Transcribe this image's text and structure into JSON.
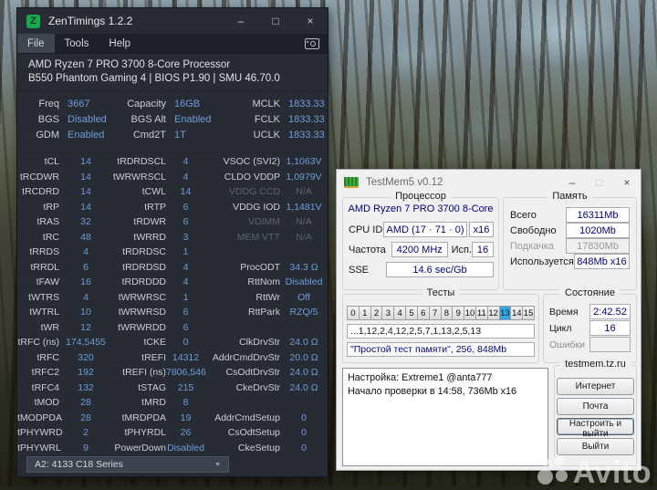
{
  "zentimings": {
    "window_title": "ZenTimings 1.2.2",
    "logo_letter": "Z",
    "controls": {
      "minimize": "–",
      "maximize": "□",
      "close": "×"
    },
    "menu": [
      "File",
      "Tools",
      "Help"
    ],
    "cpu_line1": "AMD Ryzen 7 PRO 3700 8-Core Processor",
    "board_line": "B550 Phantom Gaming 4 | BIOS P1.90 | SMU 46.70.0",
    "freq_rows": [
      {
        "c1l": "Freq",
        "c1v": "3667",
        "c2l": "Capacity",
        "c2v": "16GB",
        "c3l": "MCLK",
        "c3v": "1833.33"
      },
      {
        "c1l": "BGS",
        "c1v": "Disabled",
        "c2l": "BGS Alt",
        "c2v": "Enabled",
        "c3l": "FCLK",
        "c3v": "1833.33"
      },
      {
        "c1l": "GDM",
        "c1v": "Enabled",
        "c2l": "Cmd2T",
        "c2v": "1T",
        "c3l": "UCLK",
        "c3v": "1833.33"
      }
    ],
    "timing_rows": [
      {
        "c1l": "tCL",
        "c1v": "14",
        "c2l": "tRDRDSCL",
        "c2v": "4",
        "c3l": "VSOC (SVI2)",
        "c3v": "1,1063V",
        "c3na": false
      },
      {
        "c1l": "tRCDWR",
        "c1v": "14",
        "c2l": "tWRWRSCL",
        "c2v": "4",
        "c3l": "CLDO VDDP",
        "c3v": "1,0979V",
        "c3na": false
      },
      {
        "c1l": "tRCDRD",
        "c1v": "14",
        "c2l": "tCWL",
        "c2v": "14",
        "c3l": "VDDG CCD",
        "c3v": "N/A",
        "c3na": true
      },
      {
        "c1l": "tRP",
        "c1v": "14",
        "c2l": "tRTP",
        "c2v": "6",
        "c3l": "VDDG IOD",
        "c3v": "1,1481V",
        "c3na": false
      },
      {
        "c1l": "tRAS",
        "c1v": "32",
        "c2l": "tRDWR",
        "c2v": "6",
        "c3l": "VDIMM",
        "c3v": "N/A",
        "c3na": true
      },
      {
        "c1l": "tRC",
        "c1v": "48",
        "c2l": "tWRRD",
        "c2v": "3",
        "c3l": "MEM VTT",
        "c3v": "N/A",
        "c3na": true
      },
      {
        "c1l": "tRRDS",
        "c1v": "4",
        "c2l": "tRDRDSC",
        "c2v": "1",
        "c3l": "",
        "c3v": "",
        "c3na": false
      },
      {
        "c1l": "tRRDL",
        "c1v": "6",
        "c2l": "tRDRDSD",
        "c2v": "4",
        "c3l": "ProcODT",
        "c3v": "34.3 Ω",
        "c3na": false
      },
      {
        "c1l": "tFAW",
        "c1v": "16",
        "c2l": "tRDRDDD",
        "c2v": "4",
        "c3l": "RttNom",
        "c3v": "Disabled",
        "c3na": false
      },
      {
        "c1l": "tWTRS",
        "c1v": "4",
        "c2l": "tWRWRSC",
        "c2v": "1",
        "c3l": "RttWr",
        "c3v": "Off",
        "c3na": false
      },
      {
        "c1l": "tWTRL",
        "c1v": "10",
        "c2l": "tWRWRSD",
        "c2v": "6",
        "c3l": "RttPark",
        "c3v": "RZQ/5",
        "c3na": false
      },
      {
        "c1l": "tWR",
        "c1v": "12",
        "c2l": "tWRWRDD",
        "c2v": "6",
        "c3l": "",
        "c3v": "",
        "c3na": false
      },
      {
        "c1l": "tRFC (ns)",
        "c1v": "174,5455",
        "c2l": "tCKE",
        "c2v": "0",
        "c3l": "ClkDrvStr",
        "c3v": "24.0 Ω",
        "c3na": false
      },
      {
        "c1l": "tRFC",
        "c1v": "320",
        "c2l": "tREFI",
        "c2v": "14312",
        "c3l": "AddrCmdDrvStr",
        "c3v": "20.0 Ω",
        "c3na": false
      },
      {
        "c1l": "tRFC2",
        "c1v": "192",
        "c2l": "tREFI (ns)",
        "c2v": "7806,546",
        "c3l": "CsOdtDrvStr",
        "c3v": "24.0 Ω",
        "c3na": false
      },
      {
        "c1l": "tRFC4",
        "c1v": "132",
        "c2l": "tSTAG",
        "c2v": "215",
        "c3l": "CkeDrvStr",
        "c3v": "24.0 Ω",
        "c3na": false
      },
      {
        "c1l": "tMOD",
        "c1v": "28",
        "c2l": "tMRD",
        "c2v": "8",
        "c3l": "",
        "c3v": "",
        "c3na": false
      },
      {
        "c1l": "tMODPDA",
        "c1v": "28",
        "c2l": "tMRDPDA",
        "c2v": "19",
        "c3l": "AddrCmdSetup",
        "c3v": "0",
        "c3na": false
      },
      {
        "c1l": "tPHYWRD",
        "c1v": "2",
        "c2l": "tPHYRDL",
        "c2v": "26",
        "c3l": "CsOdtSetup",
        "c3v": "0",
        "c3na": false
      },
      {
        "c1l": "tPHYWRL",
        "c1v": "9",
        "c2l": "PowerDown",
        "c2v": "Disabled",
        "c3l": "CkeSetup",
        "c3v": "0",
        "c3na": false
      }
    ],
    "profile_selector": "A2: 4133 C18 Series"
  },
  "testmem5": {
    "window_title": "TestMem5 v0.12",
    "controls": {
      "minimize": "–",
      "maximize": "□",
      "close": "×"
    },
    "processor": {
      "title": "Процессор",
      "cpu_name": "AMD Ryzen 7 PRO 3700 8-Core",
      "cpu_id_label": "CPU ID",
      "cpu_id": "AMD (17 · 71 · 0)",
      "threads": "x16",
      "freq_label": "Частота",
      "freq": "4200 MHz",
      "used_label": "Исп.",
      "used": "16",
      "sse_label": "SSE",
      "sse": "14.6 sec/Gb"
    },
    "memory": {
      "title": "Память",
      "rows": [
        {
          "label": "Всего",
          "value": "16311Mb",
          "disabled": false,
          "wide": false
        },
        {
          "label": "Свободно",
          "value": "1020Mb",
          "disabled": false,
          "wide": false
        },
        {
          "label": "Подкачка",
          "value": "17830Mb",
          "disabled": true,
          "wide": false
        },
        {
          "label": "Используется",
          "value": "848Mb x16",
          "disabled": false,
          "wide": true
        }
      ]
    },
    "tests": {
      "title": "Тесты",
      "numbers": [
        "0",
        "1",
        "2",
        "3",
        "4",
        "5",
        "6",
        "7",
        "8",
        "9",
        "10",
        "11",
        "12",
        "13",
        "14",
        "15"
      ],
      "selected": "13",
      "sequence": "...1,12,2,4,12,2,5,7,1,13,2,5,13",
      "description": "\"Простой тест памяти\", 256, 848Mb"
    },
    "status": {
      "title": "Состояние",
      "rows": [
        {
          "label": "Время",
          "value": "2:42.52",
          "disabled": false
        },
        {
          "label": "Цикл",
          "value": "16",
          "disabled": false
        },
        {
          "label": "Ошибки",
          "value": "",
          "disabled": true
        }
      ]
    },
    "links": {
      "title": "testmem.tz.ru",
      "buttons": [
        "Интернет",
        "Почта",
        "Настроить и выйти",
        "Выйти"
      ]
    },
    "log_lines": [
      "Настройка: Extreme1 @anta777",
      "Начало проверки в 14:58, 736Mb x16"
    ]
  },
  "watermark": {
    "text": "Avito"
  },
  "colors": {
    "zt_value_blue": "#6e9cd8",
    "zt_na_gray": "#5a6170",
    "tm_value_navy": "#00008a",
    "test_selected": "#3aa5dc",
    "logo_green": "#17a74f"
  }
}
